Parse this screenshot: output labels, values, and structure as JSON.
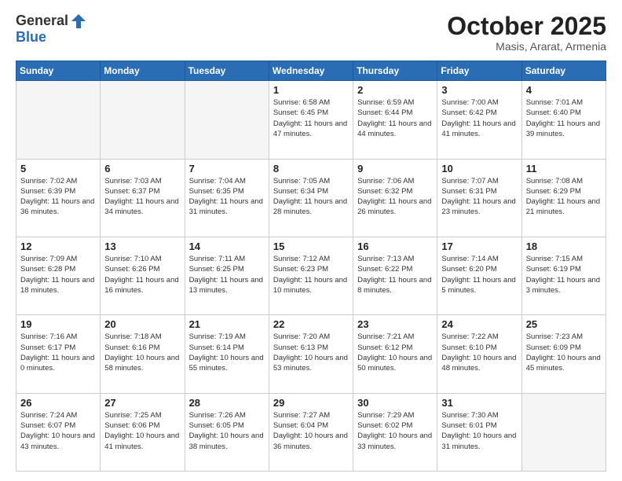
{
  "header": {
    "logo_general": "General",
    "logo_blue": "Blue",
    "title": "October 2025",
    "subtitle": "Masis, Ararat, Armenia"
  },
  "days_of_week": [
    "Sunday",
    "Monday",
    "Tuesday",
    "Wednesday",
    "Thursday",
    "Friday",
    "Saturday"
  ],
  "weeks": [
    [
      {
        "day": "",
        "info": ""
      },
      {
        "day": "",
        "info": ""
      },
      {
        "day": "",
        "info": ""
      },
      {
        "day": "1",
        "info": "Sunrise: 6:58 AM\nSunset: 6:45 PM\nDaylight: 11 hours and 47 minutes."
      },
      {
        "day": "2",
        "info": "Sunrise: 6:59 AM\nSunset: 6:44 PM\nDaylight: 11 hours and 44 minutes."
      },
      {
        "day": "3",
        "info": "Sunrise: 7:00 AM\nSunset: 6:42 PM\nDaylight: 11 hours and 41 minutes."
      },
      {
        "day": "4",
        "info": "Sunrise: 7:01 AM\nSunset: 6:40 PM\nDaylight: 11 hours and 39 minutes."
      }
    ],
    [
      {
        "day": "5",
        "info": "Sunrise: 7:02 AM\nSunset: 6:39 PM\nDaylight: 11 hours and 36 minutes."
      },
      {
        "day": "6",
        "info": "Sunrise: 7:03 AM\nSunset: 6:37 PM\nDaylight: 11 hours and 34 minutes."
      },
      {
        "day": "7",
        "info": "Sunrise: 7:04 AM\nSunset: 6:35 PM\nDaylight: 11 hours and 31 minutes."
      },
      {
        "day": "8",
        "info": "Sunrise: 7:05 AM\nSunset: 6:34 PM\nDaylight: 11 hours and 28 minutes."
      },
      {
        "day": "9",
        "info": "Sunrise: 7:06 AM\nSunset: 6:32 PM\nDaylight: 11 hours and 26 minutes."
      },
      {
        "day": "10",
        "info": "Sunrise: 7:07 AM\nSunset: 6:31 PM\nDaylight: 11 hours and 23 minutes."
      },
      {
        "day": "11",
        "info": "Sunrise: 7:08 AM\nSunset: 6:29 PM\nDaylight: 11 hours and 21 minutes."
      }
    ],
    [
      {
        "day": "12",
        "info": "Sunrise: 7:09 AM\nSunset: 6:28 PM\nDaylight: 11 hours and 18 minutes."
      },
      {
        "day": "13",
        "info": "Sunrise: 7:10 AM\nSunset: 6:26 PM\nDaylight: 11 hours and 16 minutes."
      },
      {
        "day": "14",
        "info": "Sunrise: 7:11 AM\nSunset: 6:25 PM\nDaylight: 11 hours and 13 minutes."
      },
      {
        "day": "15",
        "info": "Sunrise: 7:12 AM\nSunset: 6:23 PM\nDaylight: 11 hours and 10 minutes."
      },
      {
        "day": "16",
        "info": "Sunrise: 7:13 AM\nSunset: 6:22 PM\nDaylight: 11 hours and 8 minutes."
      },
      {
        "day": "17",
        "info": "Sunrise: 7:14 AM\nSunset: 6:20 PM\nDaylight: 11 hours and 5 minutes."
      },
      {
        "day": "18",
        "info": "Sunrise: 7:15 AM\nSunset: 6:19 PM\nDaylight: 11 hours and 3 minutes."
      }
    ],
    [
      {
        "day": "19",
        "info": "Sunrise: 7:16 AM\nSunset: 6:17 PM\nDaylight: 11 hours and 0 minutes."
      },
      {
        "day": "20",
        "info": "Sunrise: 7:18 AM\nSunset: 6:16 PM\nDaylight: 10 hours and 58 minutes."
      },
      {
        "day": "21",
        "info": "Sunrise: 7:19 AM\nSunset: 6:14 PM\nDaylight: 10 hours and 55 minutes."
      },
      {
        "day": "22",
        "info": "Sunrise: 7:20 AM\nSunset: 6:13 PM\nDaylight: 10 hours and 53 minutes."
      },
      {
        "day": "23",
        "info": "Sunrise: 7:21 AM\nSunset: 6:12 PM\nDaylight: 10 hours and 50 minutes."
      },
      {
        "day": "24",
        "info": "Sunrise: 7:22 AM\nSunset: 6:10 PM\nDaylight: 10 hours and 48 minutes."
      },
      {
        "day": "25",
        "info": "Sunrise: 7:23 AM\nSunset: 6:09 PM\nDaylight: 10 hours and 45 minutes."
      }
    ],
    [
      {
        "day": "26",
        "info": "Sunrise: 7:24 AM\nSunset: 6:07 PM\nDaylight: 10 hours and 43 minutes."
      },
      {
        "day": "27",
        "info": "Sunrise: 7:25 AM\nSunset: 6:06 PM\nDaylight: 10 hours and 41 minutes."
      },
      {
        "day": "28",
        "info": "Sunrise: 7:26 AM\nSunset: 6:05 PM\nDaylight: 10 hours and 38 minutes."
      },
      {
        "day": "29",
        "info": "Sunrise: 7:27 AM\nSunset: 6:04 PM\nDaylight: 10 hours and 36 minutes."
      },
      {
        "day": "30",
        "info": "Sunrise: 7:29 AM\nSunset: 6:02 PM\nDaylight: 10 hours and 33 minutes."
      },
      {
        "day": "31",
        "info": "Sunrise: 7:30 AM\nSunset: 6:01 PM\nDaylight: 10 hours and 31 minutes."
      },
      {
        "day": "",
        "info": ""
      }
    ]
  ]
}
